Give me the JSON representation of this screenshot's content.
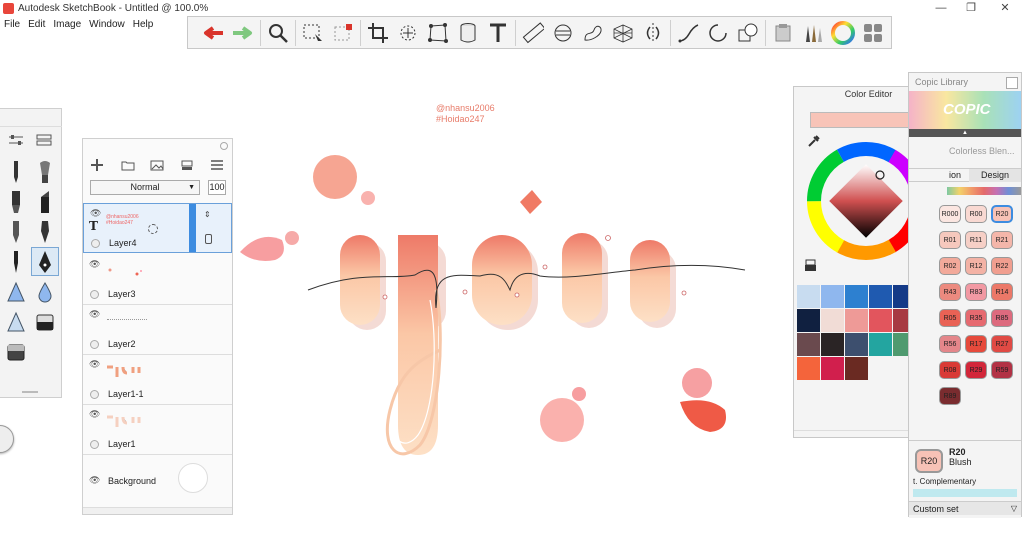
{
  "window": {
    "title": "Autodesk SketchBook - Untitled @ 100.0%",
    "minimize": "—",
    "restore": "❐",
    "close": "✕"
  },
  "menu": [
    "File",
    "Edit",
    "Image",
    "Window",
    "Help"
  ],
  "toolbar_icons": [
    "undo-icon",
    "redo-icon",
    "zoom-icon",
    "select-icon",
    "transform-icon",
    "crop-icon",
    "lasso-icon",
    "distort-icon",
    "symmetry-icon",
    "text-icon",
    "ruler-icon",
    "ellipse-guide-icon",
    "french-curve-icon",
    "perspective-icon",
    "mirror-icon",
    "stroke-icon",
    "circle-icon",
    "shape-icon",
    "copic-icon",
    "brushes-icon",
    "color-wheel-icon",
    "palette-icon"
  ],
  "tools": {
    "icons": [
      "pencil",
      "airbrush",
      "marker",
      "chisel",
      "pen",
      "nib",
      "ink",
      "fountain",
      "triangle",
      "drop",
      "triangle-light",
      "eraser",
      "eraser-dark"
    ]
  },
  "layers": {
    "blend_mode": "Normal",
    "opacity": "100",
    "items": [
      {
        "name": "Layer4",
        "thumb_text_1": "@nhansu2006",
        "thumb_text_2": "#Hoidao247",
        "selected": true
      },
      {
        "name": "Layer3",
        "selected": false
      },
      {
        "name": "Layer2",
        "selected": false
      },
      {
        "name": "Layer1-1",
        "selected": false
      },
      {
        "name": "Layer1",
        "selected": false
      },
      {
        "name": "Background",
        "selected": false
      }
    ]
  },
  "canvas": {
    "handle": "@nhansu2006",
    "hashtag": "#Hoidao247"
  },
  "color_editor": {
    "title": "Color Editor",
    "current_color": "#f8c4b8",
    "swatches": [
      "#c8dcf0",
      "#8fb7ee",
      "#2d80d0",
      "#1f5ab0",
      "#143a87",
      "#1e2f52",
      "#102040",
      "#f1dcd6",
      "#ee9a97",
      "#e2555d",
      "#a73a42",
      "#8e2325",
      "#6a4a4e",
      "#2a2425",
      "#3d4f6e",
      "#23a5a0",
      "#4f9a6f",
      "#f4a73b",
      "#f4643b",
      "#d11f4d",
      "#6a2a22"
    ]
  },
  "copic": {
    "title": "Copic Library",
    "brand": "COPIC",
    "colorless_label": "Colorless Blen...",
    "tab_left": "ion",
    "tab_right": "Design",
    "chips": [
      {
        "label": "R000",
        "color": "#fbe6e1"
      },
      {
        "label": "R00",
        "color": "#f9d9d2"
      },
      {
        "label": "R20",
        "color": "#f7c2b6"
      },
      {
        "label": "R01",
        "color": "#f6c8bd"
      },
      {
        "label": "R11",
        "color": "#f6cfc6"
      },
      {
        "label": "R21",
        "color": "#f4b6aa"
      },
      {
        "label": "R02",
        "color": "#f2a99a"
      },
      {
        "label": "R12",
        "color": "#f3b2a5"
      },
      {
        "label": "R22",
        "color": "#f09e8f"
      },
      {
        "label": "R43",
        "color": "#ec8a7f"
      },
      {
        "label": "R83",
        "color": "#f299a3"
      },
      {
        "label": "R14",
        "color": "#ec7868"
      },
      {
        "label": "R05",
        "color": "#e96255"
      },
      {
        "label": "R35",
        "color": "#e66a70"
      },
      {
        "label": "R85",
        "color": "#dd6a7e"
      },
      {
        "label": "R56",
        "color": "#e4868a"
      },
      {
        "label": "R17",
        "color": "#e64a3c"
      },
      {
        "label": "R27",
        "color": "#e04a44"
      },
      {
        "label": "R08",
        "color": "#d93a36"
      },
      {
        "label": "R29",
        "color": "#d2273a"
      },
      {
        "label": "R59",
        "color": "#b23245"
      },
      {
        "label": "R89",
        "color": "#7a2c2f"
      }
    ],
    "selected": {
      "code": "R20",
      "name": "Blush",
      "color": "#f7c2b6"
    },
    "complementary": "t. Complementary",
    "custom_set": "Custom set"
  }
}
